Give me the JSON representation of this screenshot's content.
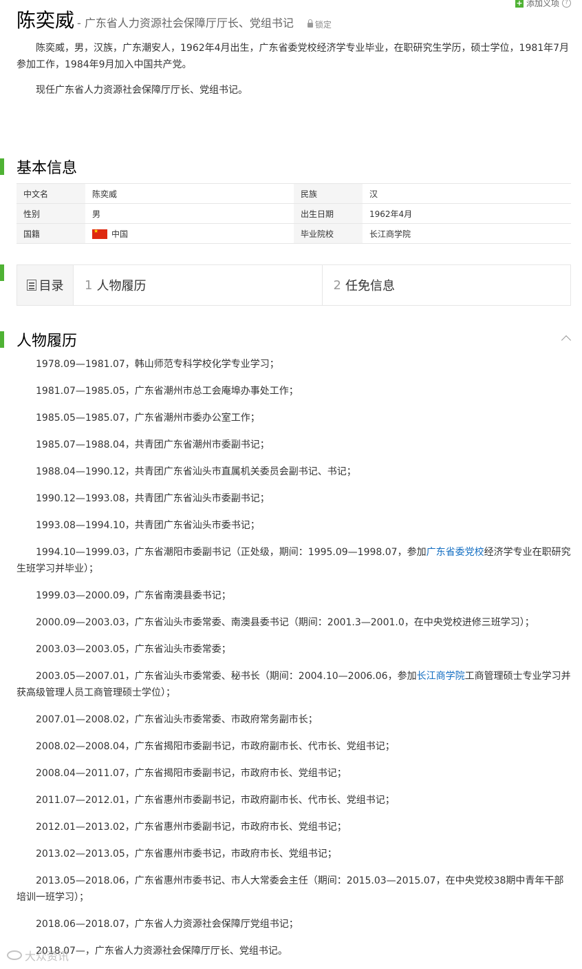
{
  "header": {
    "add_sense_label": "添加义项",
    "help_glyph": "?",
    "name": "陈奕威",
    "description": "- 广东省人力资源社会保障厅厅长、党组书记",
    "lock_label": "锁定"
  },
  "summary": [
    "陈奕威，男，汉族，广东潮安人，1962年4月出生，广东省委党校经济学专业毕业，在职研究生学历，硕士学位，1981年7月参加工作，1984年9月加入中国共产党。",
    "现任广东省人力资源社会保障厅厅长、党组书记。"
  ],
  "basic_info": {
    "heading": "基本信息",
    "rows": [
      [
        {
          "k": "中文名",
          "v": "陈奕威"
        },
        {
          "k": "民族",
          "v": "汉"
        }
      ],
      [
        {
          "k": "性别",
          "v": "男"
        },
        {
          "k": "出生日期",
          "v": "1962年4月"
        }
      ],
      [
        {
          "k": "国籍",
          "v": "中国"
        },
        {
          "k": "毕业院校",
          "v": "长江商学院"
        }
      ]
    ]
  },
  "catalog": {
    "heading": "目录",
    "items": [
      {
        "num": "1",
        "label": "人物履历"
      },
      {
        "num": "2",
        "label": "任免信息"
      }
    ]
  },
  "career": {
    "heading": "人物履历",
    "entries": [
      {
        "text": "1978.09—1981.07，韩山师范专科学校化学专业学习；"
      },
      {
        "text": "1981.07—1985.05，广东省潮州市总工会庵埠办事处工作；"
      },
      {
        "text": "1985.05—1985.07，广东省潮州市委办公室工作；"
      },
      {
        "text": "1985.07—1988.04，共青团广东省潮州市委副书记；"
      },
      {
        "text": "1988.04—1990.12，共青团广东省汕头市直属机关委员会副书记、书记；"
      },
      {
        "text": "1990.12—1993.08，共青团广东省汕头市委副书记；"
      },
      {
        "text": "1993.08—1994.10，共青团广东省汕头市委书记；"
      },
      {
        "pre": "1994.10—1999.03，广东省潮阳市委副书记（正处级，期间：1995.09—1998.07，参加",
        "link": "广东省委党校",
        "post": "经济学专业在职研究生班学习并毕业）；"
      },
      {
        "text": "1999.03—2000.09，广东省南澳县委书记；"
      },
      {
        "text": "2000.09—2003.03，广东省汕头市委常委、南澳县委书记（期间：2001.3—2001.0，在中央党校进修三班学习）；"
      },
      {
        "text": "2003.03—2003.05，广东省汕头市委常委；"
      },
      {
        "pre": "2003.05—2007.01，广东省汕头市委常委、秘书长（期间：2004.10—2006.06，参加",
        "link": "长江商学院",
        "post": "工商管理硕士专业学习并获高级管理人员工商管理硕士学位）；"
      },
      {
        "text": "2007.01—2008.02，广东省汕头市委常委、市政府常务副市长；"
      },
      {
        "text": "2008.02—2008.04，广东省揭阳市委副书记，市政府副市长、代市长、党组书记；"
      },
      {
        "text": "2008.04—2011.07，广东省揭阳市委副书记，市政府市长、党组书记；"
      },
      {
        "text": "2011.07—2012.01，广东省惠州市委副书记，市政府副市长、代市长、党组书记；"
      },
      {
        "text": "2012.01—2013.02，广东省惠州市委副书记，市政府市长、党组书记；"
      },
      {
        "text": "2013.02—2013.05，广东省惠州市委书记，市政府市长、党组书记；"
      },
      {
        "text": "2013.05—2018.06，广东省惠州市委书记、市人大常委会主任（期间：2015.03—2015.07，在中央党校38期中青年干部培训一班学习）；"
      },
      {
        "text": "2018.06—2018.07，广东省人力资源社会保障厅党组书记；"
      },
      {
        "text": "2018.07—，广东省人力资源社会保障厅厅长、党组书记。"
      }
    ]
  },
  "watermark": "大众资讯"
}
